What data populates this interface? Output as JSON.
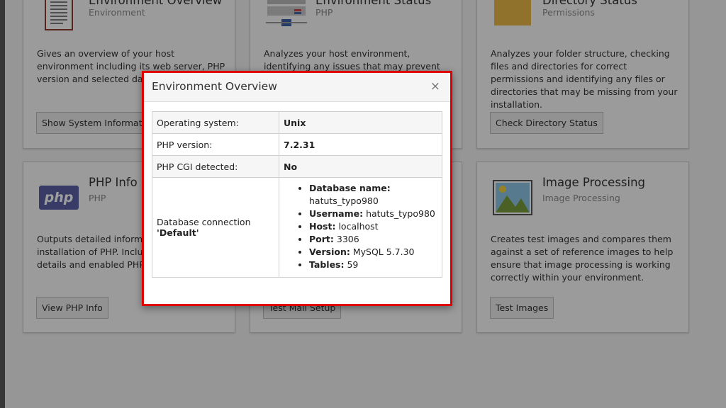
{
  "cards": [
    {
      "title": "Environment Overview",
      "subtitle": "Environment",
      "desc": "Gives an overview of your host environment including its web server, PHP version and selected database.",
      "button": "Show System Information"
    },
    {
      "title": "Environment Status",
      "subtitle": "PHP",
      "desc": "Analyzes your host environment, identifying any issues that may prevent",
      "button": ""
    },
    {
      "title": "Directory Status",
      "subtitle": "Permissions",
      "desc": "Analyzes your folder structure, checking files and directories for correct permissions and identifying any files or directories that may be missing from your installation.",
      "button": "Check Directory Status"
    },
    {
      "title": "PHP Info",
      "subtitle": "PHP",
      "icon_text": "php",
      "desc": "Outputs detailed information about your installation of PHP. Including version details and enabled PHP extensions.",
      "button": "View PHP Info"
    },
    {
      "title": "",
      "subtitle": "",
      "desc": "",
      "button": "Test Mail Setup"
    },
    {
      "title": "Image Processing",
      "subtitle": "Image Processing",
      "desc": "Creates test images and compares them against a set of reference images to help ensure that image processing is working correctly within your environment.",
      "button": "Test Images"
    }
  ],
  "modal": {
    "title": "Environment Overview",
    "close": "×",
    "rows": [
      {
        "label": "Operating system:",
        "value": "Unix"
      },
      {
        "label": "PHP version:",
        "value": "7.2.31"
      },
      {
        "label": "PHP CGI detected:",
        "value": "No"
      }
    ],
    "db": {
      "label": "Database connection",
      "name": "'Default'",
      "items": [
        {
          "k": "Database name:",
          "v": "hatuts_typo980"
        },
        {
          "k": "Username:",
          "v": "hatuts_typo980"
        },
        {
          "k": "Host:",
          "v": "localhost"
        },
        {
          "k": "Port:",
          "v": "3306"
        },
        {
          "k": "Version:",
          "v": "MySQL 5.7.30"
        },
        {
          "k": "Tables:",
          "v": "59"
        }
      ]
    }
  },
  "colors": {
    "highlight_border": "#e00000",
    "php_icon": "#5b60a3",
    "folder_icon": "#e8b94a"
  }
}
